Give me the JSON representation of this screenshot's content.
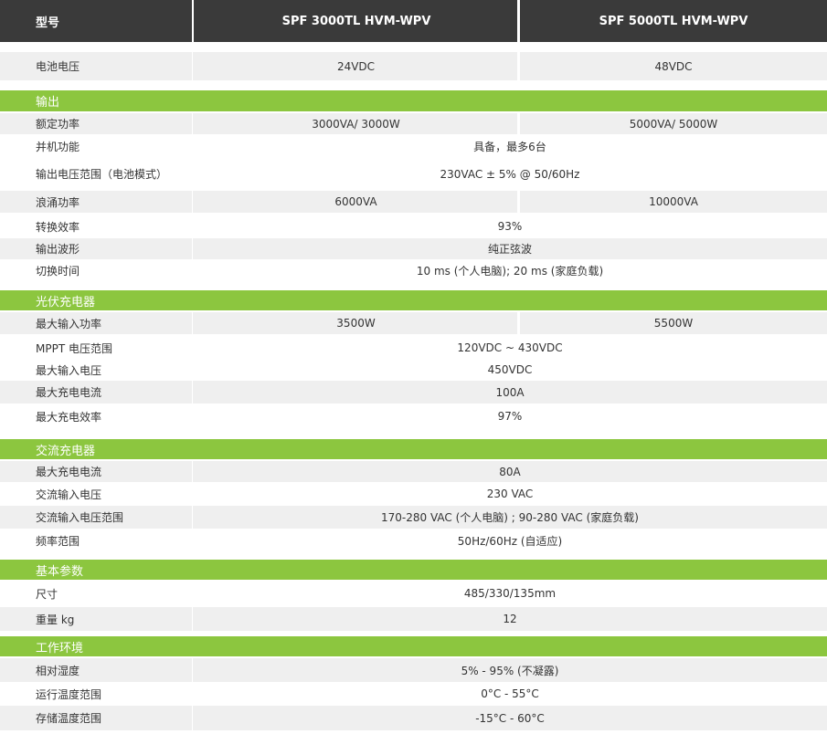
{
  "colors": {
    "header_bg": "#3a3a3a",
    "section_bg": "#8cc63f",
    "row_alt_bg": "#efefef",
    "text": "#333333"
  },
  "header": {
    "label": "型号",
    "model1": "SPF 3000TL HVM-WPV",
    "model2": "SPF 5000TL HVM-WPV"
  },
  "battery": {
    "label": "电池电压",
    "v1": "24VDC",
    "v2": "48VDC"
  },
  "output": {
    "title": "输出",
    "rated_power": {
      "label": "额定功率",
      "v1": "3000VA/ 3000W",
      "v2": "5000VA/ 5000W"
    },
    "parallel": {
      "label": "并机功能",
      "value": "具备，最多6台"
    },
    "voltage_range": {
      "label": "输出电压范围（电池模式）",
      "value": "230VAC ± 5% @ 50/60Hz"
    },
    "surge_power": {
      "label": "浪涌功率",
      "v1": "6000VA",
      "v2": "10000VA"
    },
    "efficiency": {
      "label": "转换效率",
      "value": "93%"
    },
    "waveform": {
      "label": "输出波形",
      "value": "纯正弦波"
    },
    "transfer_time": {
      "label": "切换时间",
      "value": "10 ms (个人电脑); 20 ms (家庭负载)"
    }
  },
  "pv_charger": {
    "title": "光伏充电器",
    "max_power": {
      "label": "最大输入功率",
      "v1": "3500W",
      "v2": "5500W"
    },
    "mppt_range": {
      "label": "MPPT  电压范围",
      "value": "120VDC ~ 430VDC"
    },
    "max_voltage": {
      "label": "最大输入电压",
      "value": "450VDC"
    },
    "max_current": {
      "label": "最大充电电流",
      "value": "100A"
    },
    "max_efficiency": {
      "label": "最大充电效率",
      "value": "97%"
    }
  },
  "ac_charger": {
    "title": "交流充电器",
    "max_current": {
      "label": "最大充电电流",
      "value": "80A"
    },
    "input_voltage": {
      "label": "交流输入电压",
      "value": "230 VAC"
    },
    "input_range": {
      "label": "交流输入电压范围",
      "value": "170-280 VAC (个人电脑) ; 90-280 VAC (家庭负载)"
    },
    "frequency": {
      "label": "频率范围",
      "value": "50Hz/60Hz (自适应)"
    }
  },
  "basic": {
    "title": "基本参数",
    "size": {
      "label": "尺寸",
      "value": "485/330/135mm"
    },
    "weight": {
      "label": "重量 kg",
      "value": "12"
    }
  },
  "environment": {
    "title": "工作环境",
    "humidity": {
      "label": "相对湿度",
      "value": "5% - 95%  (不凝露)"
    },
    "op_temp": {
      "label": "运行温度范围",
      "value": "0°C - 55°C"
    },
    "storage_temp": {
      "label": "存储温度范围",
      "value": "-15°C  - 60°C"
    }
  }
}
